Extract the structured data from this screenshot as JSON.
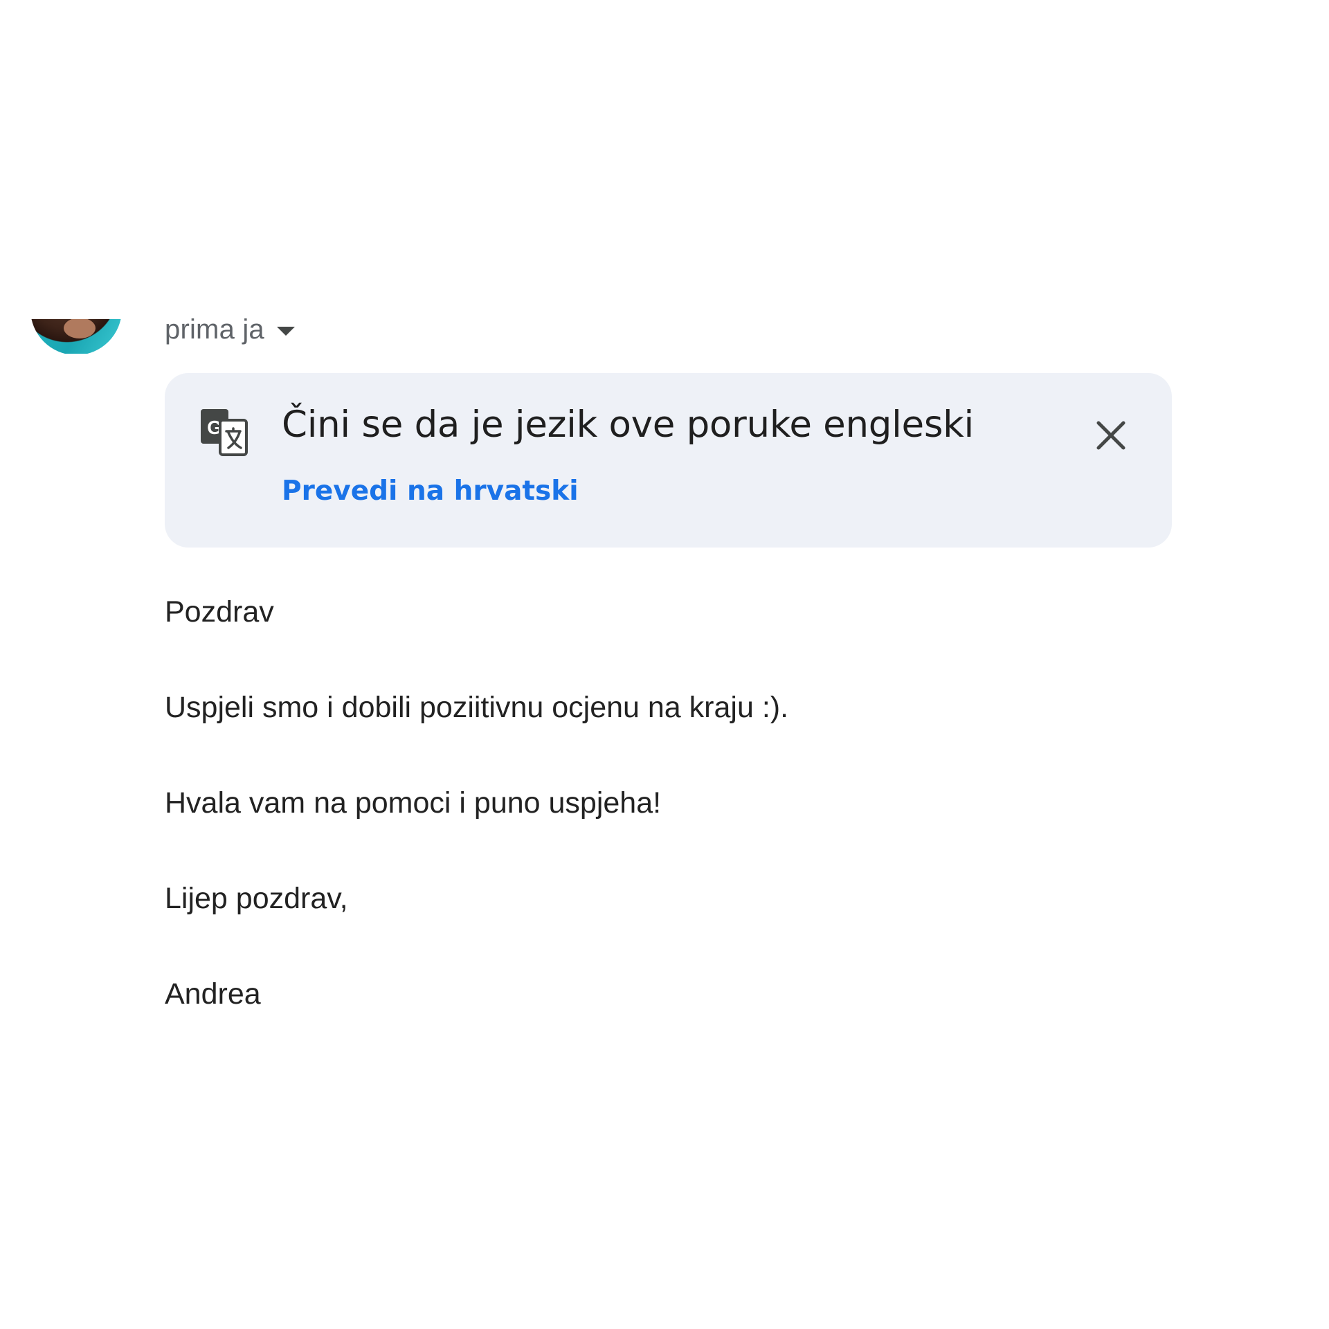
{
  "header": {
    "recipient_text": "prima ja"
  },
  "translate_banner": {
    "title": "Čini se da je jezik ove poruke engleski",
    "action_label": "Prevedi na hrvatski",
    "icon": "translate-icon",
    "close_icon": "close-icon",
    "link_color": "#1a73e8",
    "background_color": "#eef1f7"
  },
  "message": {
    "paragraphs": [
      "Pozdrav",
      "Uspjeli smo i dobili poziitivnu ocjenu na kraju :).",
      "Hvala vam na pomoci i puno uspjeha!",
      "Lijep pozdrav,",
      "Andrea"
    ]
  }
}
